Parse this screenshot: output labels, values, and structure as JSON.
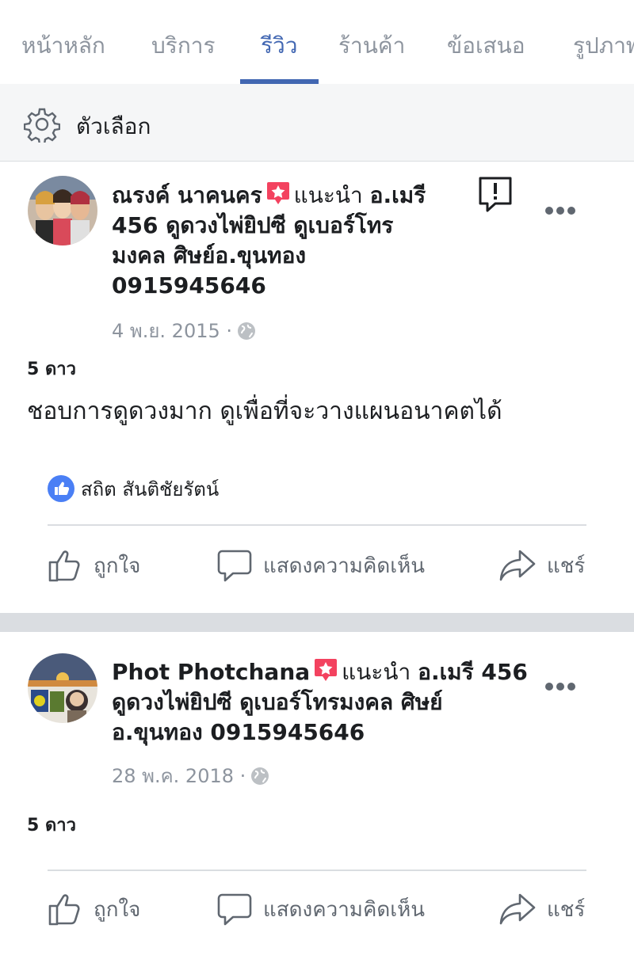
{
  "tabs": [
    {
      "label": "หน้าหลัก",
      "active": false
    },
    {
      "label": "บริการ",
      "active": false
    },
    {
      "label": "รีวิว",
      "active": true
    },
    {
      "label": "ร้านค้า",
      "active": false
    },
    {
      "label": "ข้อเสนอ",
      "active": false
    },
    {
      "label": "รูปภาพ",
      "active": false
    }
  ],
  "options": {
    "label": "ตัวเลือก",
    "icon": "gear-icon"
  },
  "posts": [
    {
      "author": "ณรงค์ นาคนคร",
      "recommends_label": "แนะนำ",
      "page_name_line1": "อ.เมรี",
      "page_name_line2": "456 ดูดวงไพ่ยิปซี ดูเบอร์โทร",
      "page_name_line3": "มงคล ศิษย์อ.ขุนทอง",
      "page_name_line4": "0915945646",
      "date": "4 พ.ย. 2015 ·",
      "rating": "5 ดาว",
      "text": "ชอบการดูดวงมาก ดูเพื่อที่จะวางแผนอนาคตได้",
      "likers": "สถิต สันติชัยรัตน์"
    },
    {
      "author": "Phot Photchana",
      "recommends_label": "แนะนำ",
      "page_name_line1": "อ.เมรี 456",
      "page_name_line2": "ดูดวงไพ่ยิปซี ดูเบอร์โทรมงคล ศิษย์",
      "page_name_line3": "อ.ขุนทอง 0915945646",
      "date": "28 พ.ค. 2018 ·",
      "rating": "5 ดาว"
    }
  ],
  "actions": {
    "like": "ถูกใจ",
    "comment": "แสดงความคิดเห็น",
    "share": "แชร์"
  },
  "colors": {
    "accent": "#4267b2",
    "muted": "#8d949e",
    "badge": "#f3425f"
  }
}
